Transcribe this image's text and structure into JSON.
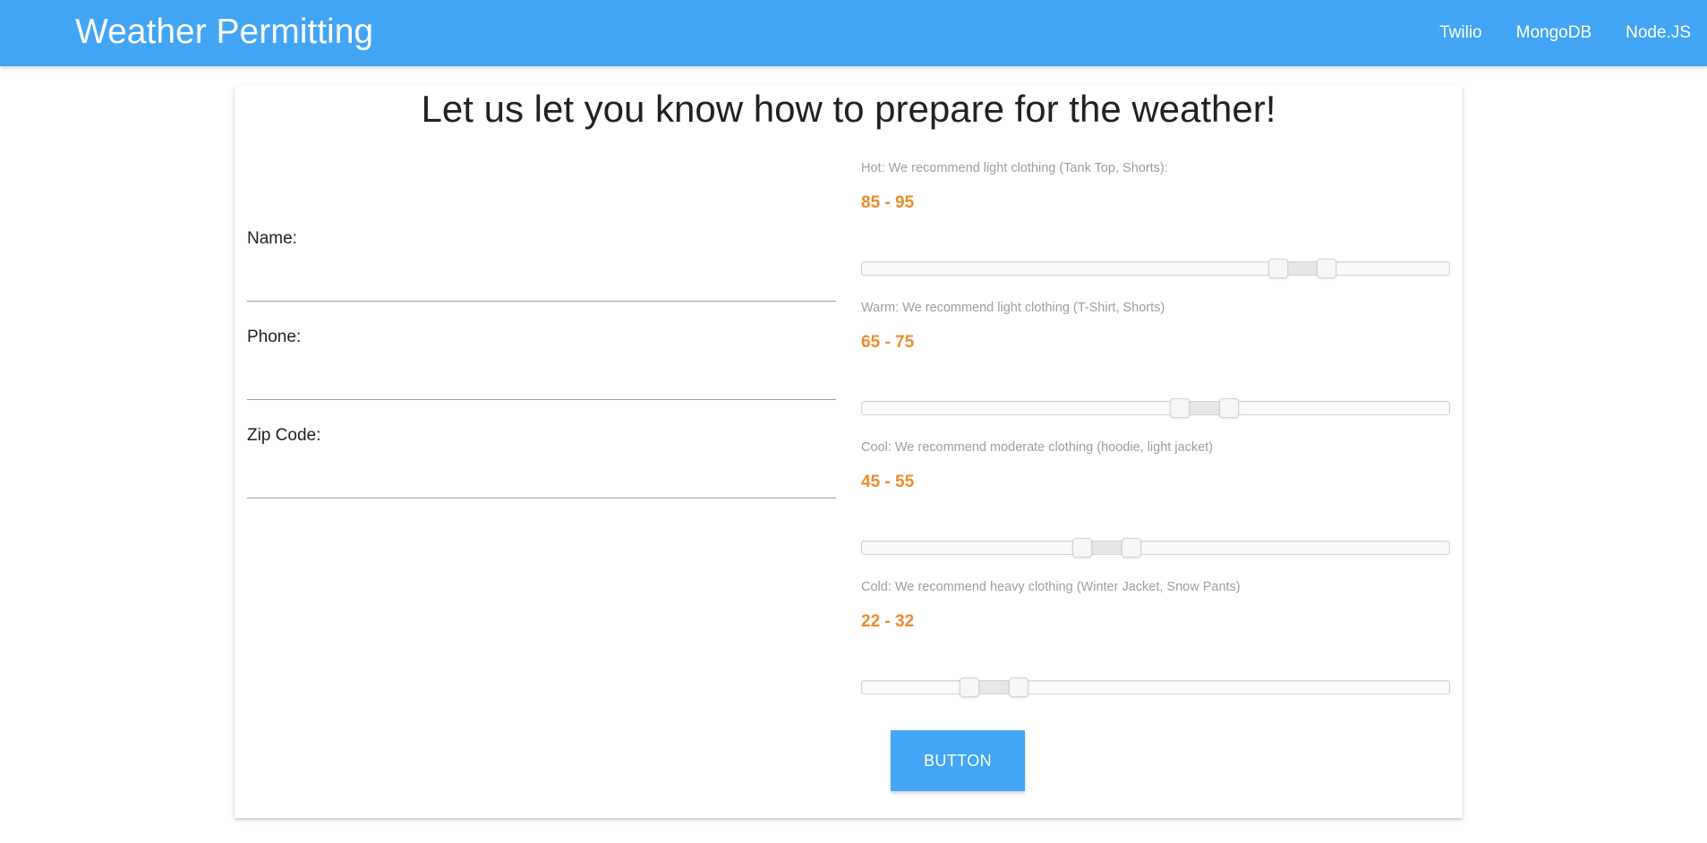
{
  "navbar": {
    "brand": "Weather Permitting",
    "links": [
      "Twilio",
      "MongoDB",
      "Node.JS"
    ]
  },
  "card": {
    "title": "Let us let you know how to prepare for the weather!"
  },
  "form": {
    "name_label": "Name:",
    "name_value": "",
    "phone_label": "Phone:",
    "phone_value": "",
    "zip_label": "Zip Code:",
    "zip_value": ""
  },
  "ranges": [
    {
      "description": "Hot: We recommend light clothing (Tank Top, Shorts):",
      "min": 85,
      "max": 95,
      "display": "85 - 95"
    },
    {
      "description": "Warm: We recommend light clothing (T-Shirt, Shorts)",
      "min": 65,
      "max": 75,
      "display": "65 - 75"
    },
    {
      "description": "Cool: We recommend moderate clothing (hoodie, light jacket)",
      "min": 45,
      "max": 55,
      "display": "45 - 55"
    },
    {
      "description": "Cold: We recommend heavy clothing (Winter Jacket, Snow Pants)",
      "min": 22,
      "max": 32,
      "display": "22 - 32"
    }
  ],
  "slider_scale": {
    "min": 0,
    "max": 120
  },
  "colors": {
    "primary": "#42a5f5",
    "range_value": "#ef8b2c"
  },
  "submit": {
    "label": "BUTTON"
  }
}
